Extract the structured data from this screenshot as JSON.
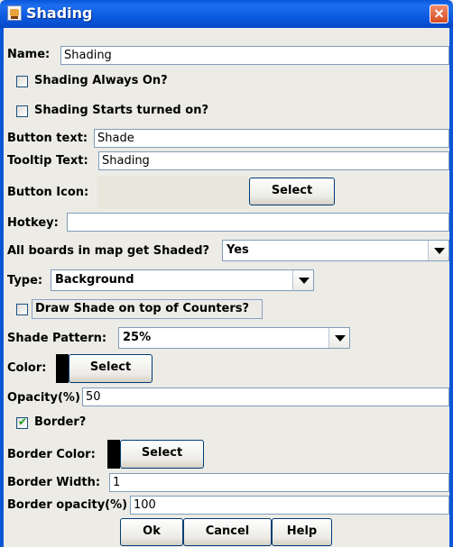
{
  "window": {
    "title": "Shading"
  },
  "name": {
    "label": "Name:",
    "value": "Shading"
  },
  "always_on": {
    "label": "Shading Always On?",
    "checked": false
  },
  "starts_on": {
    "label": "Shading Starts turned on?",
    "checked": false
  },
  "button_text": {
    "label": "Button text:",
    "value": "Shade"
  },
  "tooltip_text": {
    "label": "Tooltip Text:",
    "value": "Shading"
  },
  "button_icon": {
    "label": "Button Icon:",
    "select_label": "Select"
  },
  "hotkey": {
    "label": "Hotkey:",
    "value": ""
  },
  "all_boards": {
    "label": "All boards in map get Shaded?",
    "value": "Yes"
  },
  "type": {
    "label": "Type:",
    "value": "Background"
  },
  "draw_on_top": {
    "label": "Draw Shade on top of Counters?",
    "checked": false
  },
  "shade_pattern": {
    "label": "Shade Pattern:",
    "value": "25%"
  },
  "color": {
    "label": "Color:",
    "select_label": "Select",
    "swatch": "#000000"
  },
  "opacity": {
    "label": "Opacity(%)",
    "value": "50"
  },
  "border": {
    "label": "Border?",
    "checked": true
  },
  "border_color": {
    "label": "Border Color:",
    "select_label": "Select",
    "swatch": "#000000"
  },
  "border_width": {
    "label": "Border Width:",
    "value": "1"
  },
  "border_opacity": {
    "label": "Border opacity(%)",
    "value": "100"
  },
  "buttons": {
    "ok": "Ok",
    "cancel": "Cancel",
    "help": "Help"
  }
}
